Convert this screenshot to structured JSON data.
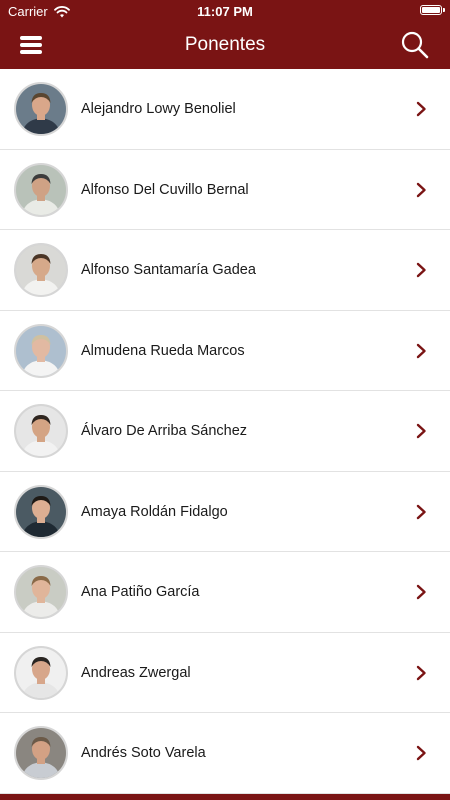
{
  "status": {
    "carrier": "Carrier",
    "time": "11:07 PM",
    "battery_level": 1.0
  },
  "header": {
    "title": "Ponentes"
  },
  "theme": {
    "primary": "#7a1414",
    "text": "#1a1a1a",
    "divider": "#e2e2e2"
  },
  "speakers": [
    {
      "name": "Alejandro Lowy Benoliel",
      "bg": "#6b7c8a",
      "skin": "#d9a78a",
      "hair": "#5a4630",
      "shirt": "#2f3a48"
    },
    {
      "name": "Alfonso Del Cuvillo Bernal",
      "bg": "#b9c2b9",
      "skin": "#cfa285",
      "hair": "#3c3c3c",
      "shirt": "#e9ebe6"
    },
    {
      "name": "Alfonso Santamaría Gadea",
      "bg": "#d9d9d6",
      "skin": "#d6a98a",
      "hair": "#4a3526",
      "shirt": "#f2f2f0"
    },
    {
      "name": "Almudena Rueda Marcos",
      "bg": "#aebfcf",
      "skin": "#e2b9a2",
      "hair": "#cfc0a0",
      "shirt": "#f4f4f4"
    },
    {
      "name": "Álvaro De Arriba Sánchez",
      "bg": "#e6e6e6",
      "skin": "#d4a484",
      "hair": "#2f2620",
      "shirt": "#f2f2f2"
    },
    {
      "name": "Amaya Roldán Fidalgo",
      "bg": "#4b5a63",
      "skin": "#dcae92",
      "hair": "#1f1a16",
      "shirt": "#1f2a33"
    },
    {
      "name": "Ana Patiño García",
      "bg": "#c9ccc4",
      "skin": "#e0b59a",
      "hair": "#8a6a48",
      "shirt": "#ececea"
    },
    {
      "name": "Andreas Zwergal",
      "bg": "#f0f0f0",
      "skin": "#d7a68a",
      "hair": "#2a2522",
      "shirt": "#e6e6e6"
    },
    {
      "name": "Andrés Soto Varela",
      "bg": "#8a8680",
      "skin": "#d3a184",
      "hair": "#6c5a48",
      "shirt": "#c8ccd2"
    }
  ]
}
